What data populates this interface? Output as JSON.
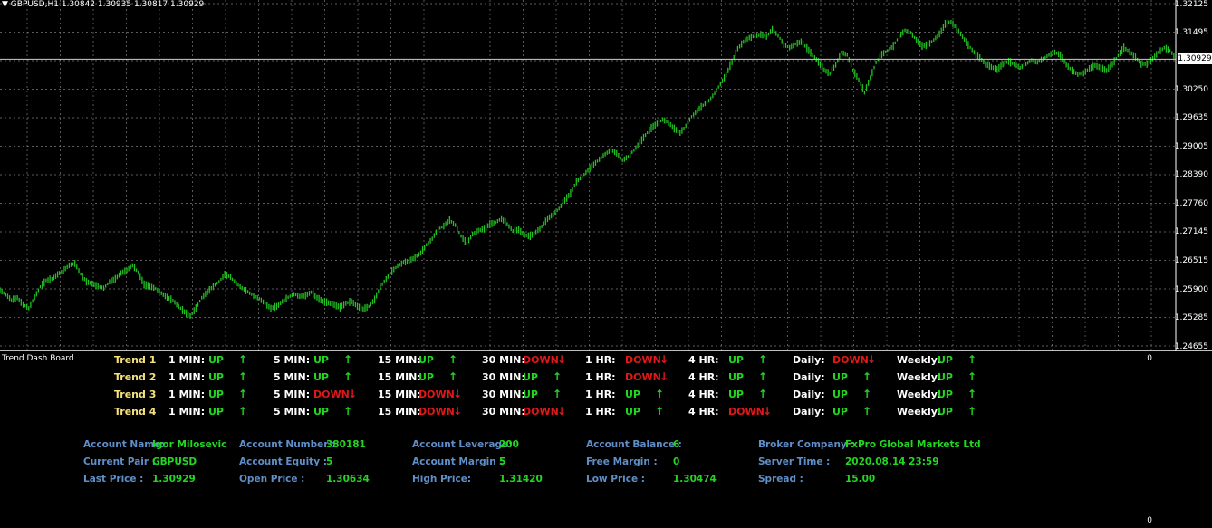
{
  "chart": {
    "title": "GBPUSD,H1  1.30842 1.30935 1.30817 1.30929",
    "price_ticks": [
      "1.32125",
      "1.31495",
      "1.30250",
      "1.29635",
      "1.29005",
      "1.28390",
      "1.27760",
      "1.27145",
      "1.26515",
      "1.25900",
      "1.25285",
      "1.24655"
    ],
    "current_price": "1.30929",
    "colors": {
      "background": "#000000",
      "grid": "#7a7a7a",
      "bars": "#22c422",
      "current_line": "#cfcfcf"
    }
  },
  "chart_data": {
    "type": "line",
    "title": "GBPUSD,H1",
    "xlabel": "",
    "ylabel": "",
    "ylim": [
      1.24655,
      1.32125
    ],
    "y": [
      1.2588,
      1.2578,
      1.2566,
      1.2571,
      1.2556,
      1.2548,
      1.2572,
      1.2595,
      1.2609,
      1.2612,
      1.2622,
      1.2631,
      1.2642,
      1.2646,
      1.2623,
      1.2606,
      1.2602,
      1.2596,
      1.2592,
      1.2606,
      1.2612,
      1.2625,
      1.2631,
      1.2642,
      1.2626,
      1.26,
      1.2596,
      1.2591,
      1.2581,
      1.2572,
      1.2565,
      1.2552,
      1.254,
      1.2531,
      1.2548,
      1.2571,
      1.2584,
      1.2596,
      1.2606,
      1.2622,
      1.2616,
      1.2602,
      1.2592,
      1.2584,
      1.2575,
      1.2569,
      1.2558,
      1.2548,
      1.2552,
      1.2563,
      1.2572,
      1.2579,
      1.2574,
      1.2576,
      1.2583,
      1.2571,
      1.2563,
      1.256,
      1.2556,
      1.255,
      1.2559,
      1.2563,
      1.2552,
      1.2546,
      1.2552,
      1.2567,
      1.2595,
      1.2612,
      1.2629,
      1.2641,
      1.2648,
      1.2652,
      1.2659,
      1.2669,
      1.2687,
      1.27,
      1.2721,
      1.2728,
      1.2741,
      1.273,
      1.2706,
      1.269,
      1.271,
      1.2718,
      1.2722,
      1.2732,
      1.2736,
      1.2744,
      1.2732,
      1.2717,
      1.272,
      1.2708,
      1.2706,
      1.2715,
      1.2727,
      1.2744,
      1.2754,
      1.2766,
      1.2784,
      1.28,
      1.2825,
      1.2836,
      1.285,
      1.2862,
      1.2874,
      1.2885,
      1.2895,
      1.2887,
      1.2871,
      1.288,
      1.2894,
      1.291,
      1.2927,
      1.2942,
      1.2952,
      1.2961,
      1.2954,
      1.2941,
      1.2932,
      1.2947,
      1.2967,
      1.2981,
      1.2992,
      1.3002,
      1.3018,
      1.3039,
      1.3059,
      1.3087,
      1.3116,
      1.3131,
      1.314,
      1.3144,
      1.3147,
      1.3143,
      1.3158,
      1.3145,
      1.3125,
      1.3118,
      1.3126,
      1.3131,
      1.3117,
      1.3102,
      1.3087,
      1.3069,
      1.3061,
      1.3081,
      1.3108,
      1.3102,
      1.3069,
      1.3048,
      1.302,
      1.3052,
      1.3086,
      1.3103,
      1.3112,
      1.3122,
      1.3142,
      1.3156,
      1.3151,
      1.3135,
      1.3122,
      1.3124,
      1.3135,
      1.3148,
      1.317,
      1.3175,
      1.3161,
      1.3142,
      1.3124,
      1.3108,
      1.3096,
      1.3082,
      1.3076,
      1.307,
      1.3082,
      1.3088,
      1.3082,
      1.3074,
      1.3082,
      1.3091,
      1.3086,
      1.3094,
      1.3102,
      1.3108,
      1.3102,
      1.3081,
      1.3068,
      1.306,
      1.3062,
      1.3072,
      1.3079,
      1.3074,
      1.3068,
      1.3082,
      1.3101,
      1.3118,
      1.3109,
      1.3098,
      1.3082,
      1.3082,
      1.3094,
      1.3108,
      1.3118,
      1.3112,
      1.3095
    ],
    "x": []
  },
  "indicator": {
    "title": "Trend Dash Board",
    "axis_top": "0",
    "axis_bottom": "0",
    "trends": [
      {
        "name": "Trend 1",
        "cells": [
          {
            "tf": "1 MIN:",
            "dir": "UP",
            "arrow": "↑"
          },
          {
            "tf": "5 MIN:",
            "dir": "UP",
            "arrow": "↑"
          },
          {
            "tf": "15 MIN:",
            "dir": "UP",
            "arrow": "↑"
          },
          {
            "tf": "30 MIN:",
            "dir": "DOWN",
            "arrow": "↓"
          },
          {
            "tf": "1 HR:",
            "dir": "DOWN",
            "arrow": "↓"
          },
          {
            "tf": "4 HR:",
            "dir": "UP",
            "arrow": "↑"
          },
          {
            "tf": "Daily:",
            "dir": "DOWN",
            "arrow": "↓"
          },
          {
            "tf": "Weekly:",
            "dir": "UP",
            "arrow": "↑"
          }
        ]
      },
      {
        "name": "Trend 2",
        "cells": [
          {
            "tf": "1 MIN:",
            "dir": "UP",
            "arrow": "↑"
          },
          {
            "tf": "5 MIN:",
            "dir": "UP",
            "arrow": "↑"
          },
          {
            "tf": "15 MIN:",
            "dir": "UP",
            "arrow": "↑"
          },
          {
            "tf": "30 MIN:",
            "dir": "UP",
            "arrow": "↑"
          },
          {
            "tf": "1 HR:",
            "dir": "DOWN",
            "arrow": "↓"
          },
          {
            "tf": "4 HR:",
            "dir": "UP",
            "arrow": "↑"
          },
          {
            "tf": "Daily:",
            "dir": "UP",
            "arrow": "↑"
          },
          {
            "tf": "Weekly:",
            "dir": "UP",
            "arrow": "↑"
          }
        ]
      },
      {
        "name": "Trend 3",
        "cells": [
          {
            "tf": "1 MIN:",
            "dir": "UP",
            "arrow": "↑"
          },
          {
            "tf": "5 MIN:",
            "dir": "DOWN",
            "arrow": "↓"
          },
          {
            "tf": "15 MIN:",
            "dir": "DOWN",
            "arrow": "↓"
          },
          {
            "tf": "30 MIN:",
            "dir": "UP",
            "arrow": "↑"
          },
          {
            "tf": "1 HR:",
            "dir": "UP",
            "arrow": "↑"
          },
          {
            "tf": "4 HR:",
            "dir": "UP",
            "arrow": "↑"
          },
          {
            "tf": "Daily:",
            "dir": "UP",
            "arrow": "↑"
          },
          {
            "tf": "Weekly:",
            "dir": "UP",
            "arrow": "↑"
          }
        ]
      },
      {
        "name": "Trend 4",
        "cells": [
          {
            "tf": "1 MIN:",
            "dir": "UP",
            "arrow": "↑"
          },
          {
            "tf": "5 MIN:",
            "dir": "UP",
            "arrow": "↑"
          },
          {
            "tf": "15 MIN:",
            "dir": "DOWN",
            "arrow": "↓"
          },
          {
            "tf": "30 MIN:",
            "dir": "DOWN",
            "arrow": "↓"
          },
          {
            "tf": "1 HR:",
            "dir": "UP",
            "arrow": "↑"
          },
          {
            "tf": "4 HR:",
            "dir": "DOWN",
            "arrow": "↓"
          },
          {
            "tf": "Daily:",
            "dir": "UP",
            "arrow": "↑"
          },
          {
            "tf": "Weekly:",
            "dir": "UP",
            "arrow": "↑"
          }
        ]
      }
    ]
  },
  "account": {
    "name_label": "Account Name:",
    "name": "Igor Milosevic",
    "pair_label": "Current Pair :",
    "pair": "GBPUSD",
    "last_label": "Last Price :",
    "last": "1.30929",
    "number_label": "Account Number :",
    "number": "380181",
    "equity_label": "Account Equity :",
    "equity": "5",
    "open_label": "Open Price :",
    "open": "1.30634",
    "leverage_label": "Account Leverage:",
    "leverage": "200",
    "margin_label": "Account Margin :",
    "margin": "5",
    "high_label": "High Price:",
    "high": "1.31420",
    "balance_label": "Account Balance :",
    "balance": "6",
    "free_label": "Free Margin :",
    "free": "0",
    "low_label": "Low Price :",
    "low": "1.30474",
    "broker_label": "Broker Company :",
    "broker": "FxPro Global Markets Ltd",
    "time_label": "Server Time :",
    "time": "2020.08.14 23:59",
    "spread_label": "Spread :",
    "spread": "15.00"
  }
}
